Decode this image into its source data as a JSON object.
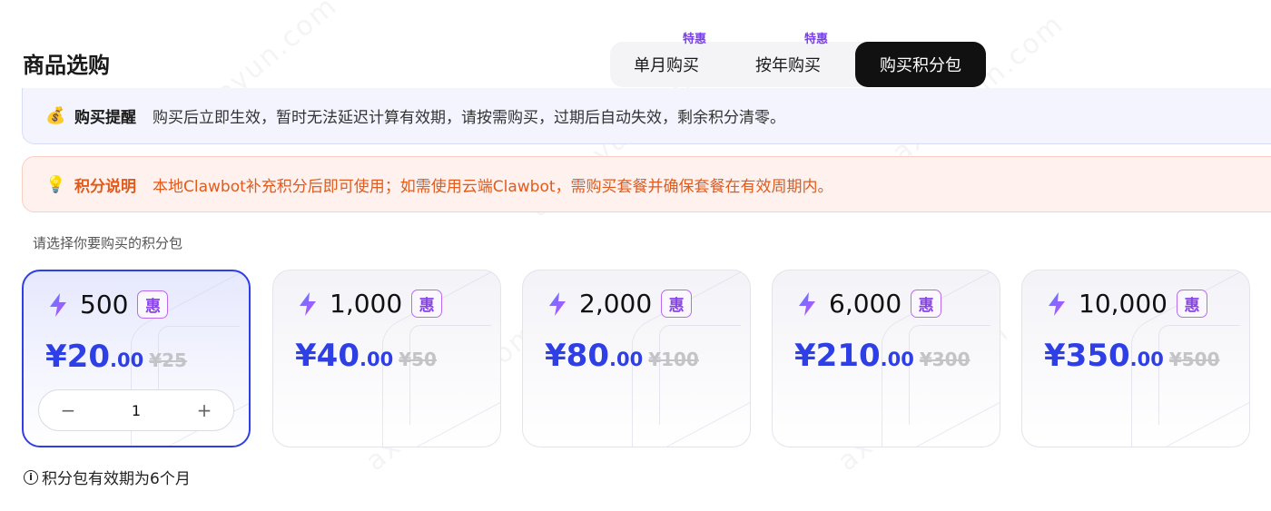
{
  "page": {
    "title": "商品选购"
  },
  "tabs": [
    {
      "label": "单月购买",
      "badge": "特惠"
    },
    {
      "label": "按年购买",
      "badge": "特惠"
    },
    {
      "label": "购买积分包",
      "badge": ""
    }
  ],
  "notices": {
    "purchase": {
      "icon": "money-bag-icon",
      "glyph": "💰",
      "title": "购买提醒",
      "text": "购买后立即生效，暂时无法延迟计算有效期，请按需购买，过期后自动失效，剩余积分清零。"
    },
    "points": {
      "icon": "lightbulb-icon",
      "glyph": "💡",
      "title": "积分说明",
      "text": "本地Clawbot补充积分后即可使用；如需使用云端Clawbot，需购买套餐并确保套餐在有效周期内。"
    }
  },
  "select_hint": "请选择你要购买的积分包",
  "packages": [
    {
      "points": "500",
      "badge": "惠",
      "price_int": "¥20",
      "price_dec": ".00",
      "price_orig": "¥25",
      "selected": true
    },
    {
      "points": "1,000",
      "badge": "惠",
      "price_int": "¥40",
      "price_dec": ".00",
      "price_orig": "¥50",
      "selected": false
    },
    {
      "points": "2,000",
      "badge": "惠",
      "price_int": "¥80",
      "price_dec": ".00",
      "price_orig": "¥100",
      "selected": false
    },
    {
      "points": "6,000",
      "badge": "惠",
      "price_int": "¥210",
      "price_dec": ".00",
      "price_orig": "¥300",
      "selected": false
    },
    {
      "points": "10,000",
      "badge": "惠",
      "price_int": "¥350",
      "price_dec": ".00",
      "price_orig": "¥500",
      "selected": false
    }
  ],
  "quantity": {
    "minus": "−",
    "value": "1",
    "plus": "+"
  },
  "validity_note": {
    "icon": "info-icon",
    "glyph": "i",
    "text": "积分包有效期为6个月"
  },
  "colors": {
    "accent": "#2f3fe6",
    "badge_purple": "#7a3cf0",
    "warning_orange": "#e25a1c",
    "tab_active_bg": "#111111"
  }
}
